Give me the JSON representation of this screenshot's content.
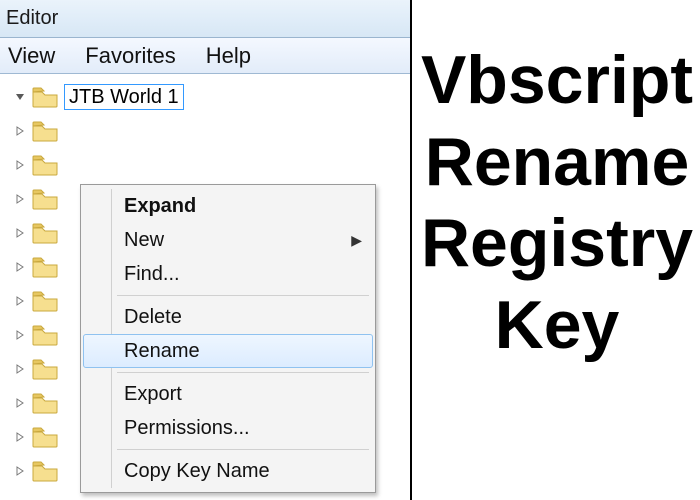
{
  "window": {
    "title_fragment": "Editor"
  },
  "menu": {
    "view": "View",
    "favorites": "Favorites",
    "help": "Help"
  },
  "tree": {
    "selected_key": "JTB World 1",
    "sibling_count_below": 11
  },
  "context_menu": {
    "expand": "Expand",
    "new": "New",
    "find": "Find...",
    "delete": "Delete",
    "rename": "Rename",
    "export": "Export",
    "permissions": "Permissions...",
    "copy_key_name": "Copy Key Name",
    "highlighted": "rename"
  },
  "headline": {
    "l1": "Vbscript",
    "l2": "Rename",
    "l3": "Registry",
    "l4": "Key"
  },
  "colors": {
    "aero_border": "#8fc2f0",
    "folder_fill": "#f6df8f",
    "folder_tab": "#e7c761"
  }
}
